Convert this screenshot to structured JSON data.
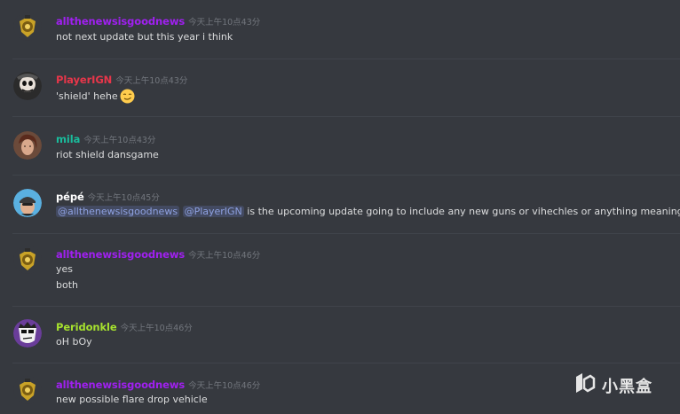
{
  "messages": [
    {
      "username": "allthenewsisgoodnews",
      "user_color": "#a020f0",
      "timestamp": "今天上午10点43分",
      "avatar_icon": "gold-badge-avatar",
      "lines": [
        "not next update but this year i think"
      ]
    },
    {
      "username": "PlayerIGN",
      "user_color": "#e8364a",
      "timestamp": "今天上午10点43分",
      "avatar_icon": "masked-character-avatar",
      "lines": [
        "'shield' hehe"
      ],
      "emoji": "smirk-emoji"
    },
    {
      "username": "mila",
      "user_color": "#1abc9c",
      "timestamp": "今天上午10点43分",
      "avatar_icon": "photo-avatar",
      "lines": [
        "riot shield dansgame"
      ]
    },
    {
      "username": "pépé",
      "user_color": "#ffffff",
      "timestamp": "今天上午10点45分",
      "avatar_icon": "helmet-person-avatar",
      "mentions": [
        "@allthenewsisgoodnews",
        "@PlayerIGN"
      ],
      "lines": [
        "is the upcoming update going to include any new guns or vihechles or anything meaningful at all?"
      ]
    },
    {
      "username": "allthenewsisgoodnews",
      "user_color": "#a020f0",
      "timestamp": "今天上午10点46分",
      "avatar_icon": "gold-badge-avatar",
      "lines": [
        "yes",
        "both"
      ]
    },
    {
      "username": "Peridonkle",
      "user_color": "#a6e22e",
      "timestamp": "今天上午10点46分",
      "avatar_icon": "cartoon-face-avatar",
      "lines": [
        "oH bOy"
      ]
    },
    {
      "username": "allthenewsisgoodnews",
      "user_color": "#a020f0",
      "timestamp": "今天上午10点46分",
      "avatar_icon": "gold-badge-avatar",
      "lines": [
        "new possible flare drop vehicle"
      ]
    }
  ],
  "watermark": {
    "text": "小黑盒",
    "icon": "heybox-logo-icon"
  }
}
